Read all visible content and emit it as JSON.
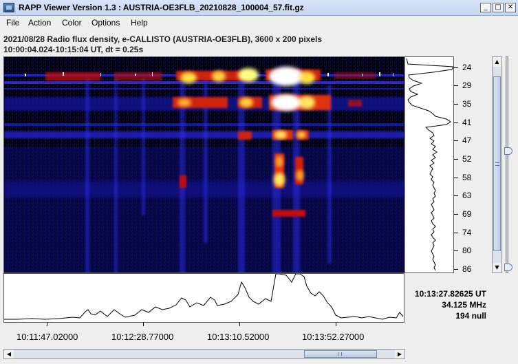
{
  "window": {
    "title": "RAPP Viewer Version 1.3 : AUSTRIA-OE3FLB_20210828_100004_57.fit.gz",
    "minimize_glyph": "_",
    "maximize_glyph": "□",
    "close_glyph": "✕"
  },
  "menu": {
    "items": [
      "File",
      "Action",
      "Color",
      "Options",
      "Help"
    ]
  },
  "info": {
    "line1": "2021/08/28  Radio flux density, e-CALLISTO (AUSTRIA-OE3FLB),  3600 x 200 pixels",
    "line2": "10:00:04.024-10:15:04 UT,  dt = 0.25s"
  },
  "freq_axis": {
    "ticks": [
      "24",
      "29",
      "35",
      "41",
      "47",
      "52",
      "58",
      "63",
      "69",
      "74",
      "80",
      "86"
    ]
  },
  "time_axis": {
    "ticks": [
      "10:11:47.02000",
      "10:12:28.77000",
      "10:13:10.52000",
      "10:13:52.27000"
    ]
  },
  "readout": {
    "time": "10:13:27.82625 UT",
    "frequency": "34.125 MHz",
    "value": "194 null"
  },
  "scroll": {
    "up_arrow": "▲",
    "down_arrow": "▼",
    "left_arrow": "◀",
    "right_arrow": "▶"
  },
  "colors": {
    "background_low": "#000014",
    "band_blue": "#1a1ab8",
    "burst_red": "#d02010",
    "burst_yellow": "#ffe040",
    "burst_white": "#ffffff"
  }
}
